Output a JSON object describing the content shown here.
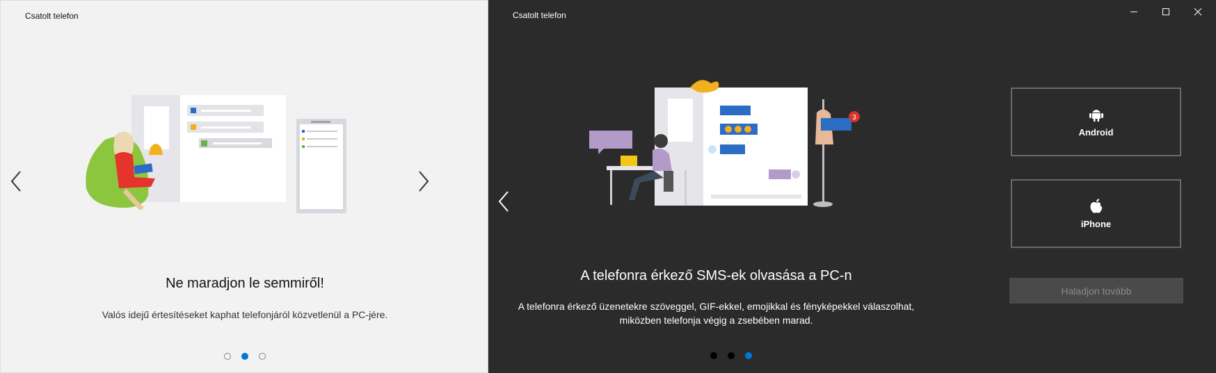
{
  "left_window": {
    "title": "Csatolt telefon",
    "heading": "Ne maradjon le semmiről!",
    "description": "Valós idejű értesítéseket kaphat telefonjáról közvetlenül a PC-jére.",
    "carousel": {
      "page_count": 3,
      "active_index": 1
    }
  },
  "right_window": {
    "title": "Csatolt telefon",
    "heading": "A telefonra érkező SMS-ek olvasása a PC-n",
    "description_line1": "A telefonra érkező üzenetekre szöveggel, GIF-ekkel, emojikkal és fényképekkel válaszolhat,",
    "description_line2": "miközben telefonja végig a zsebében marad.",
    "carousel": {
      "page_count": 3,
      "active_index": 2
    },
    "notification_badge": "3",
    "devices": {
      "android_label": "Android",
      "iphone_label": "iPhone"
    },
    "continue_label": "Haladjon tovább",
    "window_controls": [
      "minimize-icon",
      "maximize-icon",
      "close-icon"
    ]
  },
  "colors": {
    "accent": "#0078d4",
    "left_bg": "#f2f2f2",
    "right_bg": "#2b2b2b"
  }
}
